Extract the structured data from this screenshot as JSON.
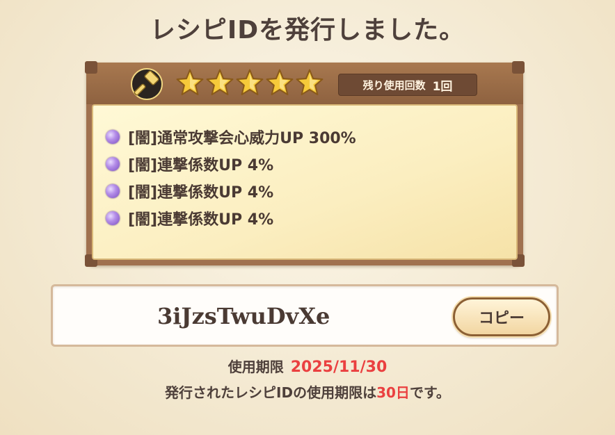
{
  "title": "レシピIDを発行しました。",
  "recipe": {
    "icon": "hammer-icon",
    "stars": 5,
    "uses_label": "残り使用回数",
    "uses_count": "1回",
    "effects": [
      "[闇]通常攻撃会心威力UP 300%",
      "[闇]連撃係数UP 4%",
      "[闇]連撃係数UP 4%",
      "[闇]連撃係数UP 4%"
    ]
  },
  "recipe_id": "3iJzsTwuDvXe",
  "copy_label": "コピー",
  "expiry": {
    "label": "使用期限",
    "date": "2025/11/30"
  },
  "note": {
    "prefix": "発行されたレシピIDの使用期限は",
    "days": "30日",
    "suffix": "です。"
  },
  "colors": {
    "highlight": "#ea4040",
    "star": "#f6c93a",
    "orb": "#a47ddd"
  }
}
